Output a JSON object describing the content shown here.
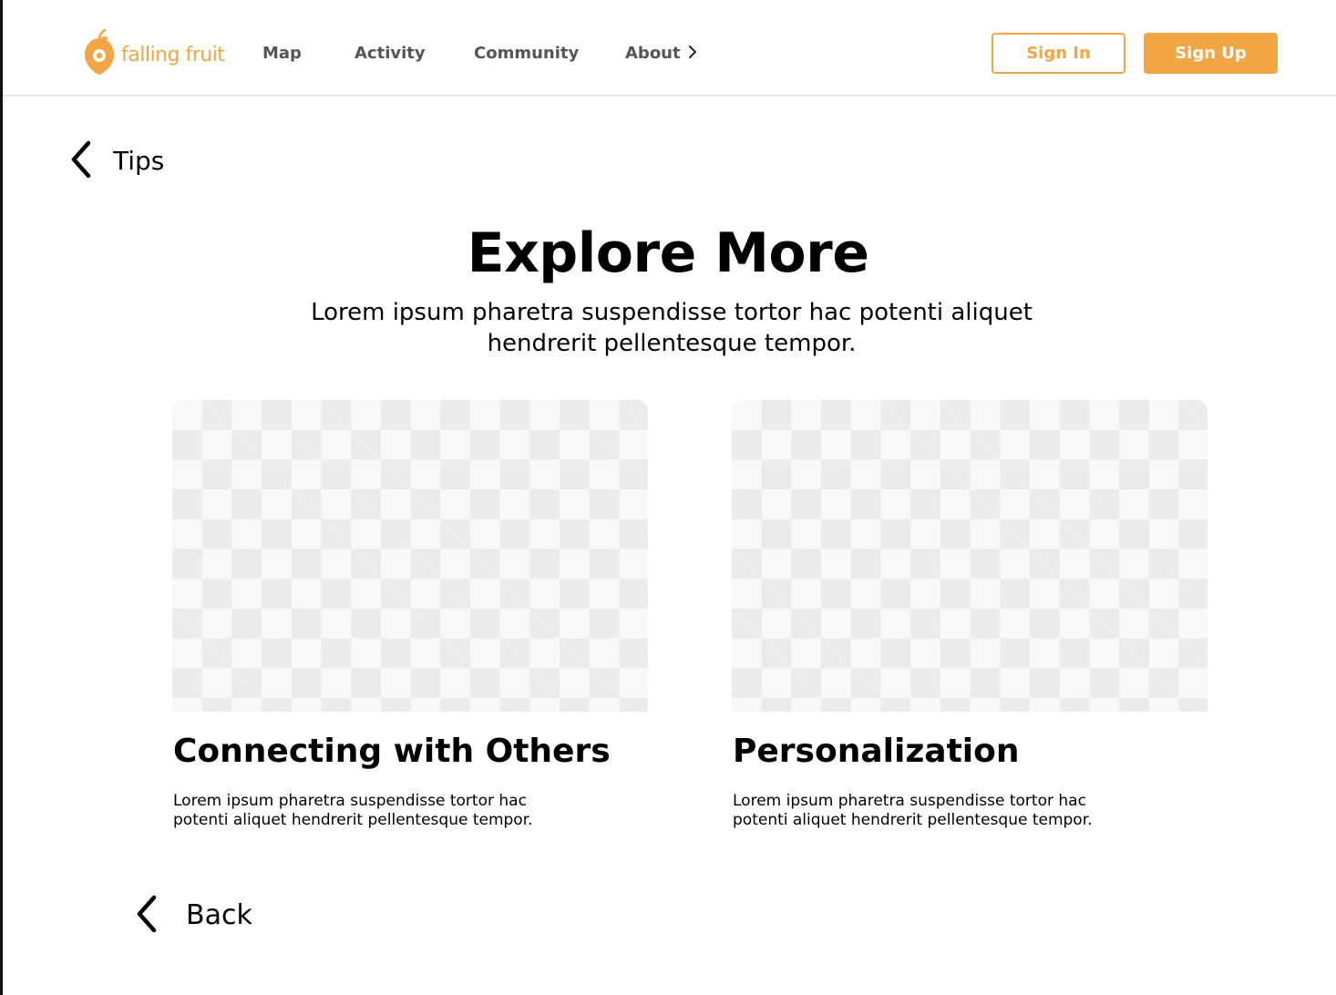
{
  "header": {
    "logo_text": "falling fruit",
    "nav": {
      "map": "Map",
      "activity": "Activity",
      "community": "Community",
      "about": "About"
    },
    "sign_in": "Sign In",
    "sign_up": "Sign Up"
  },
  "breadcrumb": {
    "label": "Tips"
  },
  "hero": {
    "title": "Explore More",
    "subtitle": "Lorem ipsum pharetra suspendisse tortor hac potenti aliquet hendrerit pellentesque tempor."
  },
  "cards": [
    {
      "title": "Connecting with Others",
      "description": "Lorem ipsum pharetra suspendisse tortor hac potenti aliquet hendrerit pellentesque tempor."
    },
    {
      "title": "Personalization",
      "description": "Lorem ipsum pharetra suspendisse tortor hac potenti aliquet hendrerit pellentesque tempor."
    }
  ],
  "footer": {
    "back_label": "Back"
  },
  "colors": {
    "brand": "#f2a543",
    "nav_text": "#555555",
    "divider": "#e6e6e6",
    "placeholder_light": "#f7f8f7",
    "placeholder_dark": "#ebebeb"
  },
  "icons": {
    "logo": "fruit-pin-icon",
    "about_chevron": "chevron-right-icon",
    "tips_back": "chevron-left-icon",
    "back": "chevron-left-icon"
  }
}
